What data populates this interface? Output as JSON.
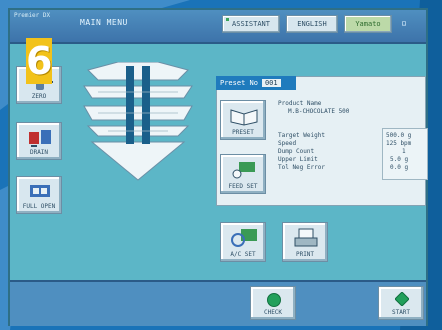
{
  "screen": {
    "model_label": "Premier DX",
    "menu_title": "MAIN MENU",
    "step_badge": "6"
  },
  "topbar": {
    "assistant": "ASSISTANT",
    "language": "ENGLISH",
    "tools": "Yamato"
  },
  "sidebar": {
    "items": [
      {
        "label": "ZERO"
      },
      {
        "label": "DRAIN"
      },
      {
        "label": "FULL OPEN"
      }
    ]
  },
  "preset": {
    "label": "Preset No",
    "number": "001",
    "product_name_label": "Product Name",
    "product_name": "M.B-CHOCOLATE 500",
    "fields": [
      "Target Weight",
      "Speed",
      "Dump Count",
      "Upper Limit",
      "Tol Neg Error"
    ],
    "values": [
      "500.0 g",
      "125 bpm",
      "1",
      "5.0 g",
      "0.0 g"
    ]
  },
  "buttons": {
    "preset": "PRESET",
    "feed_set": "FEED SET",
    "ac_set": "A/C SET",
    "print": "PRINT",
    "check": "CHECK",
    "start": "START"
  },
  "colors": {
    "screen_bg": "#5cb6c7",
    "accent": "#1f7bbd",
    "badge": "#f2c21a",
    "go_green": "#22a05b"
  }
}
